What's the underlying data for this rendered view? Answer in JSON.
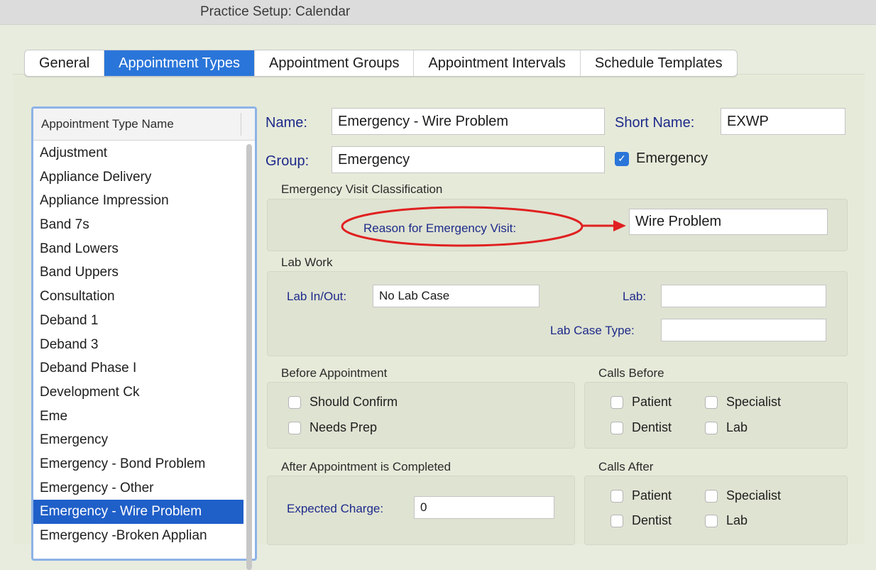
{
  "window": {
    "title": "Practice Setup: Calendar"
  },
  "tabs": [
    {
      "label": "General"
    },
    {
      "label": "Appointment Types"
    },
    {
      "label": "Appointment Groups"
    },
    {
      "label": "Appointment Intervals"
    },
    {
      "label": "Schedule Templates"
    }
  ],
  "active_tab": "Appointment Types",
  "list": {
    "header": "Appointment Type Name",
    "items": [
      "Adjustment",
      "Appliance Delivery",
      "Appliance Impression",
      "Band 7s",
      "Band Lowers",
      "Band Uppers",
      "Consultation",
      "Deband 1",
      "Deband 3",
      "Deband Phase I",
      "Development Ck",
      "Eme",
      "Emergency",
      "Emergency - Bond Problem",
      "Emergency - Other",
      "Emergency - Wire Problem",
      "Emergency -Broken Applian"
    ],
    "selected": "Emergency - Wire Problem"
  },
  "form": {
    "name_label": "Name:",
    "name_value": "Emergency - Wire Problem",
    "short_name_label": "Short Name:",
    "short_name_value": "EXWP",
    "group_label": "Group:",
    "group_value": "Emergency",
    "emergency_checkbox_label": "Emergency",
    "emergency_checked": true
  },
  "emergency_section": {
    "title": "Emergency Visit Classification",
    "reason_label": "Reason for Emergency Visit:",
    "reason_value": "Wire Problem"
  },
  "lab_section": {
    "title": "Lab Work",
    "lab_in_out_label": "Lab In/Out:",
    "lab_in_out_value": "No Lab Case",
    "lab_label": "Lab:",
    "lab_value": "",
    "lab_case_type_label": "Lab Case Type:",
    "lab_case_type_value": ""
  },
  "before_section": {
    "title": "Before Appointment",
    "should_confirm": "Should Confirm",
    "needs_prep": "Needs Prep"
  },
  "calls_before": {
    "title": "Calls Before",
    "patient": "Patient",
    "specialist": "Specialist",
    "dentist": "Dentist",
    "lab": "Lab"
  },
  "after_section": {
    "title": "After Appointment is Completed",
    "expected_charge_label": "Expected Charge:",
    "expected_charge_value": "0"
  },
  "calls_after": {
    "title": "Calls After",
    "patient": "Patient",
    "specialist": "Specialist",
    "dentist": "Dentist",
    "lab": "Lab"
  },
  "colors": {
    "accent_blue": "#2a75d9",
    "selection_blue": "#1f5fc8",
    "label_navy": "#1d2a8a",
    "annotation_red": "#e02020"
  }
}
